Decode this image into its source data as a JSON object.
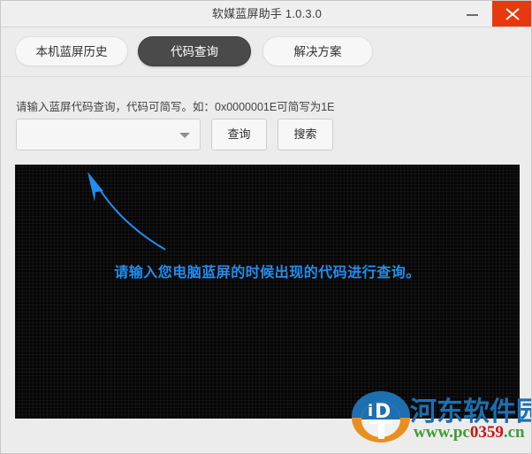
{
  "window": {
    "title": "软媒蓝屏助手 1.0.3.0",
    "minimize_label": "minimize",
    "close_label": "close",
    "close_color": "#e8380d"
  },
  "tabs": [
    {
      "label": "本机蓝屏历史",
      "active": false
    },
    {
      "label": "代码查询",
      "active": true
    },
    {
      "label": "解决方案",
      "active": false
    }
  ],
  "main": {
    "hint": "请输入蓝屏代码查询，代码可简写。如：0x0000001E可简写为1E",
    "combo": {
      "value": "",
      "placeholder": ""
    },
    "query_button": "查询",
    "search_button": "搜索",
    "panel": {
      "message": "请输入您电脑蓝屏的时候出现的代码进行查询。",
      "message_color": "#1f8ef1",
      "background_color": "#060606",
      "arrow_color": "#1f8ef1"
    }
  },
  "watermark": {
    "site_name": "河东软件园",
    "url_prefix": "www.pc",
    "url_digits": "0359",
    "url_suffix": ".cn",
    "name_color": "#1c6fb0",
    "url_color": "#3f9c35"
  }
}
